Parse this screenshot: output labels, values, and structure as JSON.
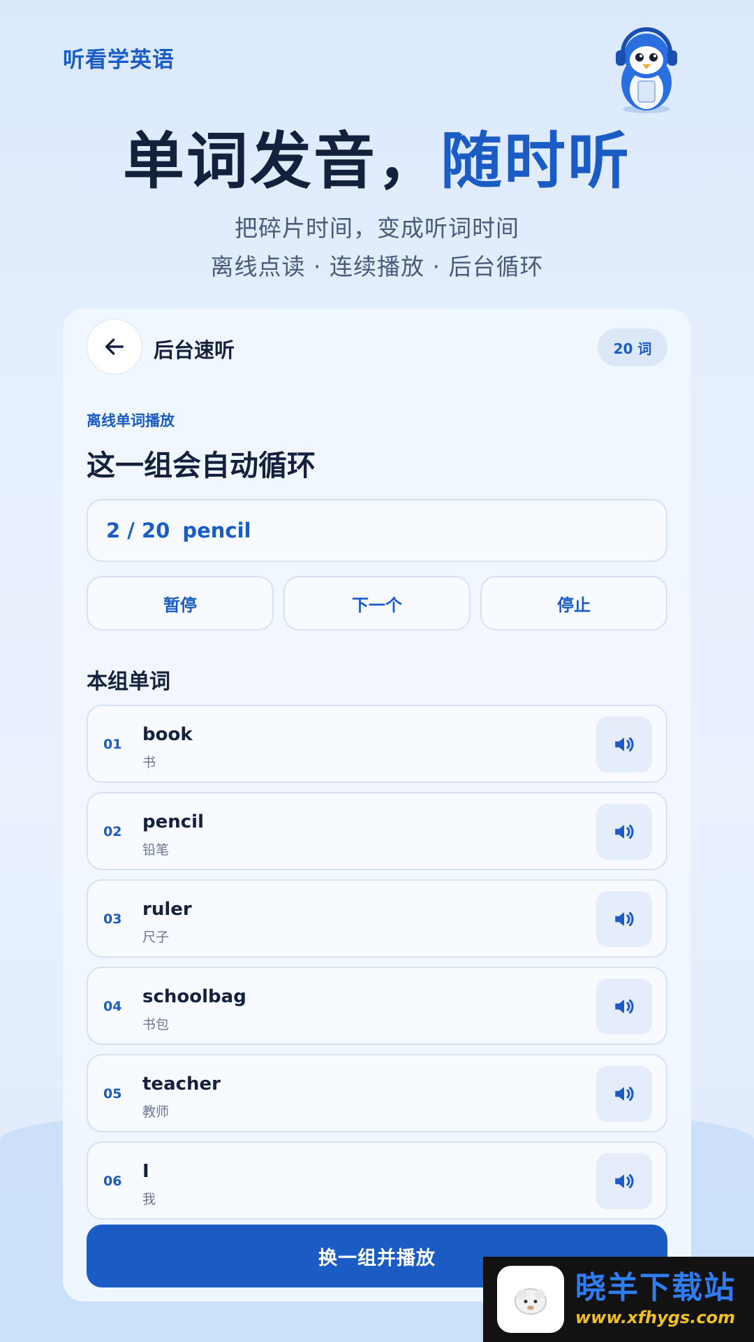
{
  "app": {
    "title": "听看学英语"
  },
  "hero": {
    "title_main": "单词发音，",
    "title_accent": "随时听",
    "subtitle_line1": "把碎片时间，变成听词时间",
    "subtitle_line2": "离线点读 · 连续播放 · 后台循环"
  },
  "card": {
    "header_title": "后台速听",
    "word_count_badge": "20 词",
    "kicker": "离线单词播放",
    "title": "这一组会自动循环",
    "now_playing": {
      "progress": "2 / 20",
      "word": "pencil"
    },
    "controls": {
      "pause_label": "暂停",
      "next_label": "下一个",
      "stop_label": "停止"
    },
    "list_heading": "本组单词",
    "words": [
      {
        "num": "01",
        "en": "book",
        "cn": "书"
      },
      {
        "num": "02",
        "en": "pencil",
        "cn": "铅笔"
      },
      {
        "num": "03",
        "en": "ruler",
        "cn": "尺子"
      },
      {
        "num": "04",
        "en": "schoolbag",
        "cn": "书包"
      },
      {
        "num": "05",
        "en": "teacher",
        "cn": "教师"
      },
      {
        "num": "06",
        "en": "I",
        "cn": "我"
      }
    ],
    "primary_button": "换一组并播放"
  },
  "watermark": {
    "name": "晓羊下载站",
    "url": "www.xfhygs.com"
  },
  "colors": {
    "accent": "#1a5cc4",
    "text_dark": "#14213d",
    "muted": "#6a778e"
  }
}
